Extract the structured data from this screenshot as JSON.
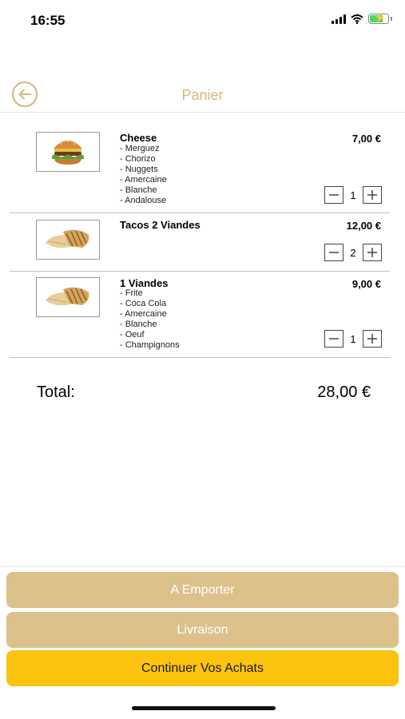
{
  "status_bar": {
    "time": "16:55",
    "icons": [
      "cellular-signal-icon",
      "wifi-icon",
      "battery-charging-icon"
    ]
  },
  "header": {
    "back_icon": "back-arrow-circle-icon",
    "title": "Panier"
  },
  "cart": {
    "items": [
      {
        "name": "Cheese",
        "image": "burger-icon",
        "options": [
          "- Merguez",
          "- Chorizo",
          "- Nuggets",
          "- Amercaine",
          "- Blanche",
          "- Andalouse"
        ],
        "price": "7,00 €",
        "quantity": "1"
      },
      {
        "name": "Tacos 2 Viandes",
        "image": "tacos-icon",
        "options": [],
        "price": "12,00 €",
        "quantity": "2"
      },
      {
        "name": "1 Viandes",
        "image": "tacos-icon",
        "options": [
          "- Frite",
          "- Coca Cola",
          "- Amercaine",
          "- Blanche",
          "- Oeuf",
          "- Champignons"
        ],
        "price": "9,00 €",
        "quantity": "1"
      }
    ]
  },
  "total": {
    "label": "Total:",
    "value": "28,00 €"
  },
  "actions": {
    "takeaway_label": "A Emporter",
    "delivery_label": "Livraison",
    "continue_label": "Continuer Vos Achats"
  },
  "colors": {
    "accent_gold": "#d8b77a",
    "button_light": "#dcc18b",
    "button_yellow": "#fcc30f"
  }
}
